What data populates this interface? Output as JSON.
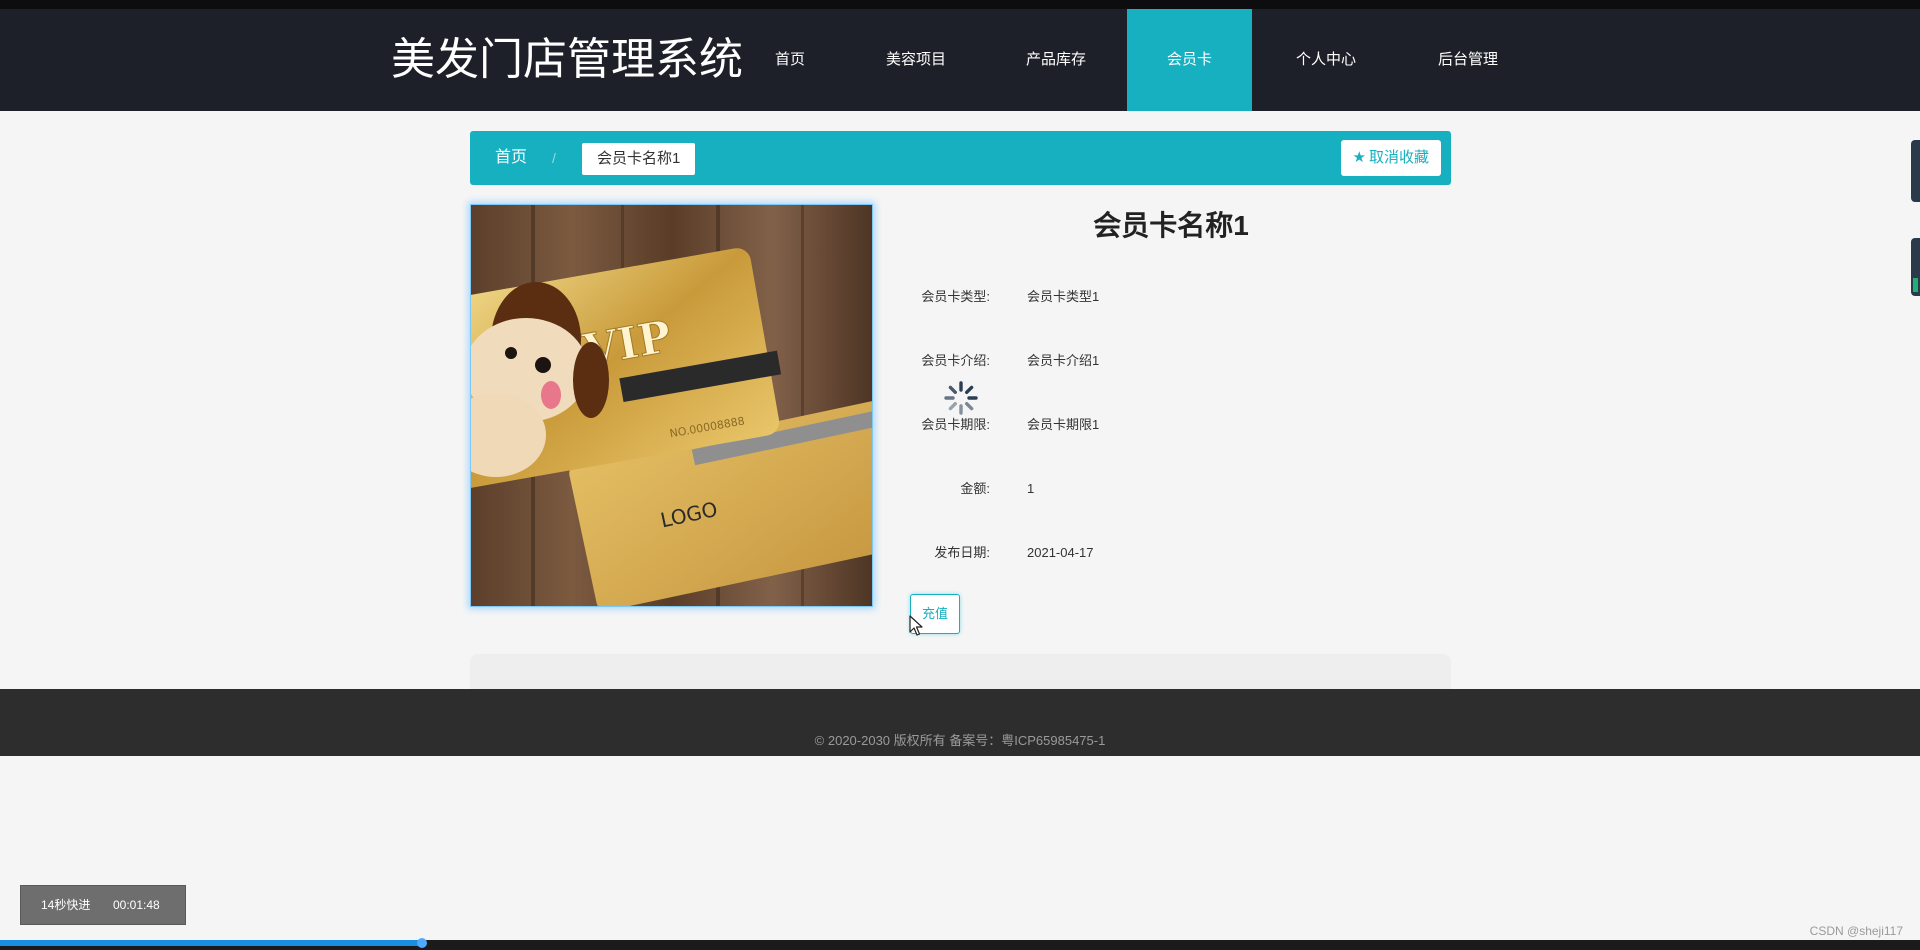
{
  "brand": {
    "title": "美发门店管理系统"
  },
  "nav": {
    "items": [
      {
        "label": "首页"
      },
      {
        "label": "美容项目"
      },
      {
        "label": "产品库存"
      },
      {
        "label": "会员卡",
        "active": true
      },
      {
        "label": "个人中心"
      },
      {
        "label": "后台管理"
      }
    ]
  },
  "breadcrumb": {
    "home": "首页",
    "separator": "/",
    "current": "会员卡名称1"
  },
  "favorite": {
    "label": "取消收藏",
    "icon": "star-icon"
  },
  "detail": {
    "title": "会员卡名称1",
    "image_icon": "vip-card-image",
    "fields": [
      {
        "key": "会员卡类型:",
        "value": "会员卡类型1"
      },
      {
        "key": "会员卡介绍:",
        "value": "会员卡介绍1"
      },
      {
        "key": "会员卡期限:",
        "value": "会员卡期限1"
      },
      {
        "key": "金额:",
        "value": "1"
      },
      {
        "key": "发布日期:",
        "value": "2021-04-17"
      }
    ],
    "recharge_label": "充值",
    "loading_icon": "loading-spinner-icon"
  },
  "footer": {
    "text": "© 2020-2030 版权所有 备案号：粤ICP65985475-1"
  },
  "playback": {
    "label": "14秒快进",
    "time": "00:01:48",
    "progress": 0.22
  },
  "watermark": {
    "text": "CSDN @sheji117"
  },
  "colors": {
    "nav_bg": "#1e2029",
    "accent": "#17b0c0",
    "footer_bg": "#2d2d2e",
    "page_bg": "#f5f5f5"
  }
}
